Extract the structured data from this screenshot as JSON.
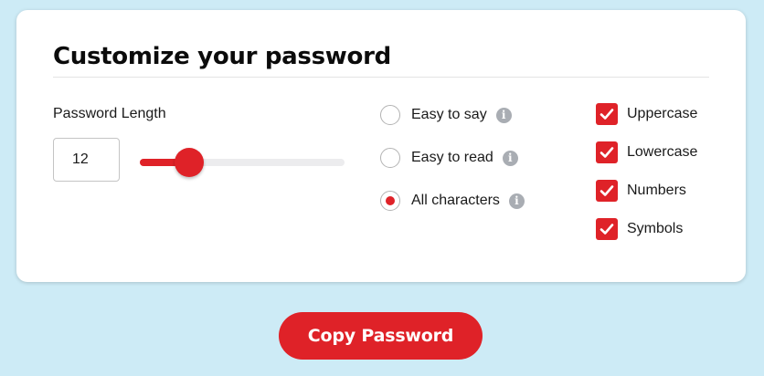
{
  "page": {
    "title": "Customize your password"
  },
  "length": {
    "label": "Password Length",
    "value": "12",
    "slider_fraction": 0.24
  },
  "modes": [
    {
      "label": "Easy to say",
      "checked": false,
      "info_icon": "info-icon"
    },
    {
      "label": "Easy to read",
      "checked": false,
      "info_icon": "info-icon"
    },
    {
      "label": "All characters",
      "checked": true,
      "info_icon": "info-icon"
    }
  ],
  "options": [
    {
      "label": "Uppercase",
      "checked": true
    },
    {
      "label": "Lowercase",
      "checked": true
    },
    {
      "label": "Numbers",
      "checked": true
    },
    {
      "label": "Symbols",
      "checked": true
    }
  ],
  "copy_button": {
    "label": "Copy Password"
  },
  "colors": {
    "background": "#cdebf6",
    "accent": "#df2228",
    "card": "#ffffff",
    "info_icon": "#a9adb3"
  }
}
